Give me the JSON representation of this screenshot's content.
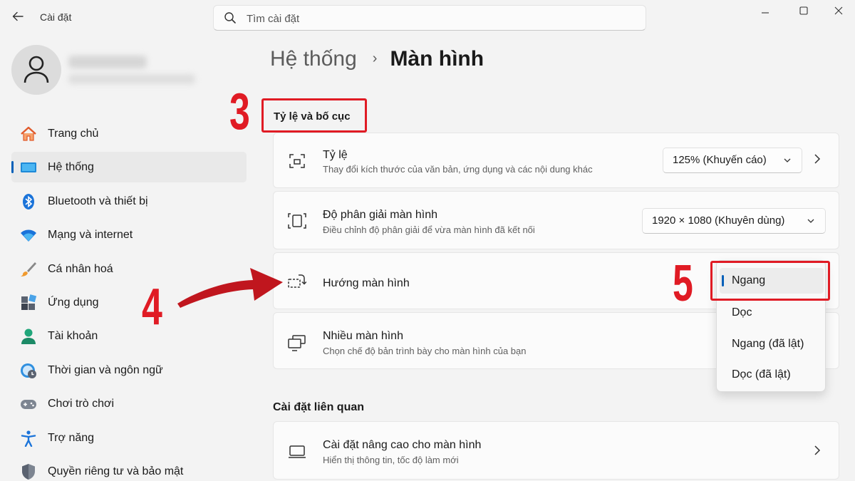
{
  "titlebar": {
    "app_title": "Cài đặt",
    "search_placeholder": "Tìm cài đặt"
  },
  "sidebar": {
    "items": [
      {
        "label": "Trang chủ",
        "icon": "home-icon"
      },
      {
        "label": "Hệ thống",
        "icon": "system-icon",
        "active": true
      },
      {
        "label": "Bluetooth và thiết bị",
        "icon": "bluetooth-icon"
      },
      {
        "label": "Mạng và internet",
        "icon": "wifi-icon"
      },
      {
        "label": "Cá nhân hoá",
        "icon": "brush-icon"
      },
      {
        "label": "Ứng dụng",
        "icon": "apps-icon"
      },
      {
        "label": "Tài khoản",
        "icon": "account-icon"
      },
      {
        "label": "Thời gian và ngôn ngữ",
        "icon": "clock-globe-icon"
      },
      {
        "label": "Chơi trò chơi",
        "icon": "gamepad-icon"
      },
      {
        "label": "Trợ năng",
        "icon": "accessibility-icon"
      },
      {
        "label": "Quyền riêng tư và bảo mật",
        "icon": "shield-icon"
      }
    ]
  },
  "breadcrumb": {
    "parent": "Hệ thống",
    "separator": "›",
    "current": "Màn hình"
  },
  "scale_layout": {
    "section_title": "Tỷ lệ và bố cục",
    "scale": {
      "title": "Tỷ lệ",
      "subtitle": "Thay đổi kích thước của văn bản, ứng dụng và các nội dung khác",
      "value": "125% (Khuyến cáo)"
    },
    "resolution": {
      "title": "Độ phân giải màn hình",
      "subtitle": "Điều chỉnh độ phân giải để vừa màn hình đã kết nối",
      "value": "1920 × 1080 (Khuyên dùng)"
    },
    "orientation": {
      "title": "Hướng màn hình",
      "options": [
        "Ngang",
        "Dọc",
        "Ngang (đã lật)",
        "Dọc (đã lật)"
      ],
      "selected": "Ngang"
    },
    "multiple_displays": {
      "title": "Nhiều màn hình",
      "subtitle": "Chọn chế độ bản trình bày cho màn hình của bạn"
    }
  },
  "related": {
    "section_title": "Cài đặt liên quan",
    "advanced": {
      "title": "Cài đặt nâng cao cho màn hình",
      "subtitle": "Hiển thị thông tin, tốc độ làm mới"
    }
  },
  "annotations": {
    "step3": "3",
    "step4": "4",
    "step5": "5",
    "color": "#e01b24"
  },
  "colors": {
    "accent": "#005fb8",
    "background": "#f3f3f3",
    "card": "#fbfbfb"
  }
}
